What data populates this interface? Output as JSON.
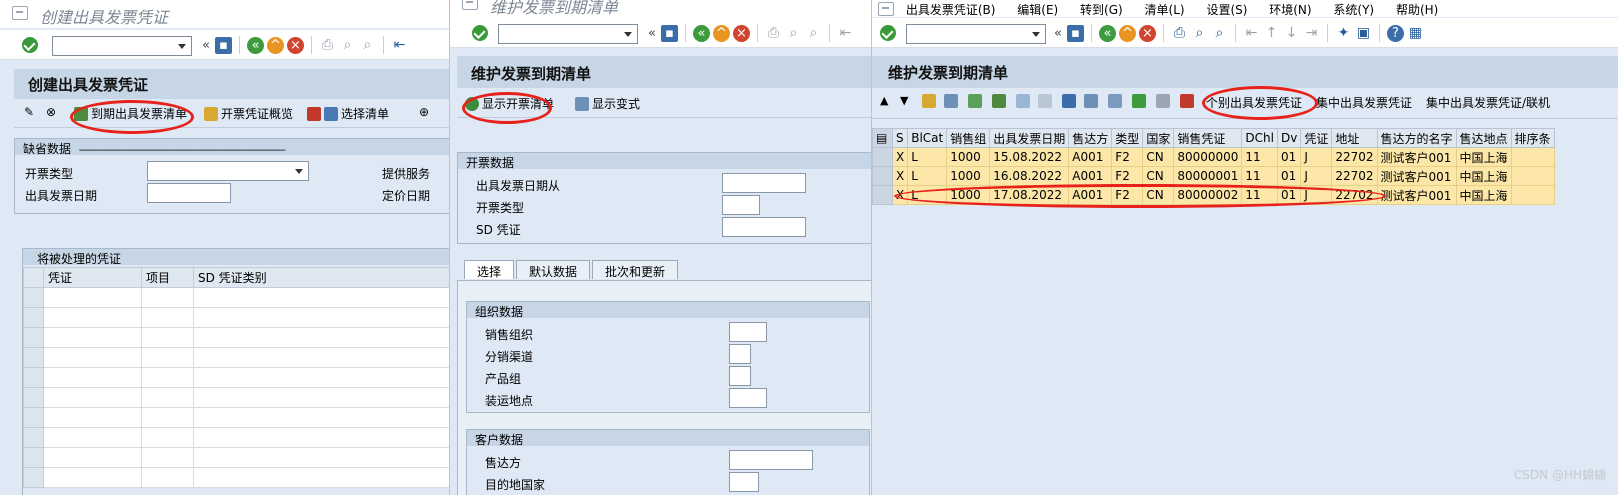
{
  "panel1": {
    "window_title": "创建出具发票凭证",
    "app_title": "创建出具发票凭证",
    "toolbar": [
      "到期出具发票清单",
      "开票凭证概览",
      "选择清单"
    ],
    "defaults_frame": {
      "title": "缺省数据",
      "dashes": "-------------------------------------------------------------------------------",
      "fields": [
        "开票类型",
        "出具发票日期"
      ],
      "right_labels": [
        "提供服务",
        "定价日期"
      ]
    },
    "docs_frame": {
      "title": "将被处理的凭证",
      "columns": [
        "凭证",
        "项目",
        "SD 凭证类别"
      ]
    }
  },
  "panel2": {
    "window_title": "维护发票到期清单",
    "app_title": "维护发票到期清单",
    "toolbar": [
      "显示开票清单",
      "显示变式"
    ],
    "billing_frame": {
      "title": "开票数据",
      "fields": [
        "出具发票日期从",
        "开票类型",
        "SD 凭证"
      ]
    },
    "tabs": [
      "选择",
      "默认数据",
      "批次和更新"
    ],
    "org_frame": {
      "title": "组织数据",
      "fields": [
        "销售组织",
        "分销渠道",
        "产品组",
        "装运地点"
      ]
    },
    "customer_frame": {
      "title": "客户数据",
      "fields": [
        "售达方",
        "目的地国家"
      ]
    }
  },
  "panel3": {
    "menu": [
      "出具发票凭证(B)",
      "编辑(E)",
      "转到(G)",
      "清单(L)",
      "设置(S)",
      "环境(N)",
      "系统(Y)",
      "帮助(H)"
    ],
    "app_title": "维护发票到期清单",
    "toolbar_buttons": [
      "个别出具发票凭证",
      "集中出具发票凭证",
      "集中出具发票凭证/联机"
    ],
    "grid": {
      "columns": [
        "S",
        "BlCat",
        "销售组",
        "出具发票日期",
        "售达方",
        "类型",
        "国家",
        "销售凭证",
        "DChl",
        "Dv",
        "凭证",
        "地址",
        "售达方的名字",
        "售达地点",
        "排序条"
      ],
      "rows": [
        [
          "X",
          "L",
          "1000",
          "15.08.2022",
          "A001",
          "F2",
          "CN",
          "80000000",
          "11",
          "01",
          "J",
          "22702",
          "测试客户001",
          "中国上海",
          ""
        ],
        [
          "X",
          "L",
          "1000",
          "16.08.2022",
          "A001",
          "F2",
          "CN",
          "80000001",
          "11",
          "01",
          "J",
          "22702",
          "测试客户001",
          "中国上海",
          ""
        ],
        [
          "X",
          "L",
          "1000",
          "17.08.2022",
          "A001",
          "F2",
          "CN",
          "80000002",
          "11",
          "01",
          "J",
          "22702",
          "测试客户001",
          "中国上海",
          ""
        ]
      ]
    }
  },
  "watermark": "CSDN @HH蝴蝴",
  "colors": {
    "sap_bg": "#dfe9f5",
    "title_band": "#c7d6e6",
    "row_highlight": "#fce7a8",
    "annotation_red": "#e8221b"
  }
}
